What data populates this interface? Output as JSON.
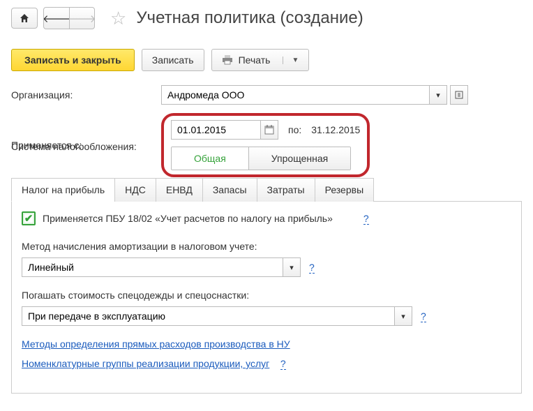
{
  "title": "Учетная политика (создание)",
  "actions": {
    "save_close": "Записать и закрыть",
    "save": "Записать",
    "print": "Печать"
  },
  "labels": {
    "organization": "Организация:",
    "applies_from": "Применяется с:",
    "to": "по:",
    "tax_system": "Система налогообложения:"
  },
  "organization": {
    "value": "Андромеда ООО"
  },
  "dates": {
    "from": "01.01.2015",
    "to": "31.12.2015"
  },
  "tax_system": {
    "options": {
      "general": "Общая",
      "simplified": "Упрощенная"
    }
  },
  "tabs": [
    "Налог на прибыль",
    "НДС",
    "ЕНВД",
    "Запасы",
    "Затраты",
    "Резервы"
  ],
  "profit_tax": {
    "pbu_label": "Применяется ПБУ 18/02 «Учет расчетов по налогу на прибыль»",
    "amort_title": "Метод начисления амортизации в налоговом учете:",
    "amort_value": "Линейный",
    "workwear_title": "Погашать стоимость спецодежды и спецоснастки:",
    "workwear_value": "При передаче в эксплуатацию",
    "link_direct_costs": "Методы определения прямых расходов производства в НУ",
    "link_nomenclature": "Номенклатурные группы реализации продукции, услуг",
    "help": "?"
  }
}
